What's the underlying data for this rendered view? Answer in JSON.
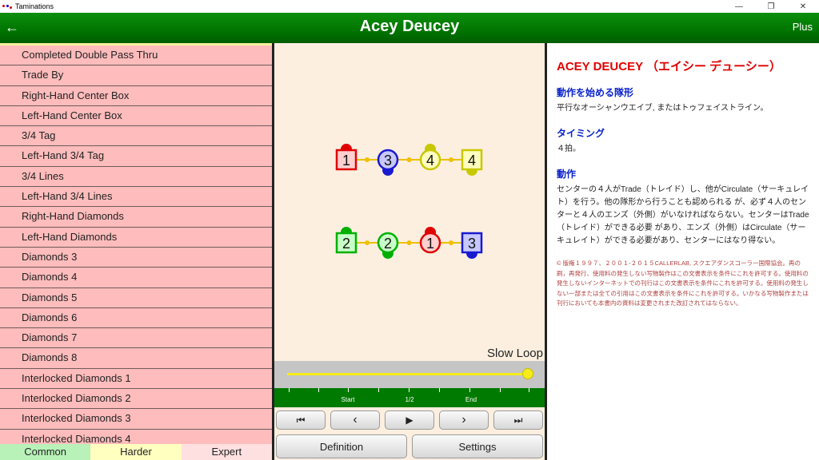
{
  "window": {
    "title": "Taminations",
    "controls": [
      "—",
      "❐",
      "✕"
    ]
  },
  "appbar": {
    "title": "Acey Deucey",
    "plus_label": "Plus",
    "back_glyph": "←"
  },
  "list": {
    "items": [
      "Completed Double Pass Thru",
      "Trade By",
      "Right-Hand Center Box",
      "Left-Hand Center Box",
      "3/4 Tag",
      "Left-Hand 3/4 Tag",
      "3/4 Lines",
      "Left-Hand 3/4 Lines",
      "Right-Hand Diamonds",
      "Left-Hand Diamonds",
      "Diamonds 3",
      "Diamonds 4",
      "Diamonds 5",
      "Diamonds 6",
      "Diamonds 7",
      "Diamonds 8",
      "Interlocked Diamonds 1",
      "Interlocked Diamonds 2",
      "Interlocked Diamonds 3",
      "Interlocked Diamonds 4"
    ]
  },
  "tabs": {
    "common": "Common",
    "harder": "Harder",
    "expert": "Expert"
  },
  "animation": {
    "slow_loop_label": "Slow Loop",
    "dancers_row1": [
      "1",
      "3",
      "4",
      "4"
    ],
    "dancers_row2": [
      "2",
      "2",
      "1",
      "3"
    ],
    "colors": {
      "red": "#e00000",
      "blue": "#1a1ad0",
      "yellow": "#c8c800",
      "green": "#00b000"
    },
    "progress": 1.0,
    "tick_labels": {
      "start": "Start",
      "half": "1/2",
      "end": "End"
    }
  },
  "playback": {
    "first_glyph": "⏮",
    "prev_glyph": "‹",
    "play_glyph": "▶",
    "next_glyph": "›",
    "last_glyph": "⏭",
    "definition_label": "Definition",
    "settings_label": "Settings"
  },
  "definition": {
    "title": "ACEY DEUCEY （エイシー デューシー）",
    "start_heading": "動作を始める隊形",
    "start_text": "平行なオーシャンウエイブ, またはトゥフェイストライン。",
    "timing_heading": "タイミング",
    "timing_text": "４拍。",
    "action_heading": "動作",
    "action_text": "センターの４人がTrade（トレイド）し、他がCirculate（サーキュレイト）を行う。他の隊形から行うことも認められる が、必ず４人のセンターと４人のエンズ（外側）がいなければならない。センターはTrade（トレイド）ができる必要 があり、エンズ（外側）はCirculate（サーキュレイト）ができる必要があり、センターにはなり得ない。",
    "copyright": "© 版権１９９７、２００１-２０１５CALLERLAB, スクエアダンスコーラー国際協会。再の刷，再発行、使用料の発生しない写物製作はこの文書表示を条件にこれを許可する。使用料の発生しないインターネットでの刊行はこの文書表示を条件にこれを許可する。使用料の発生しない一部または全ての引用はこの文書表示を条件にこれを許可する。いかなる写物製作または刊行においても本書内の資料は変更されまた改訂されてはならない。"
  }
}
